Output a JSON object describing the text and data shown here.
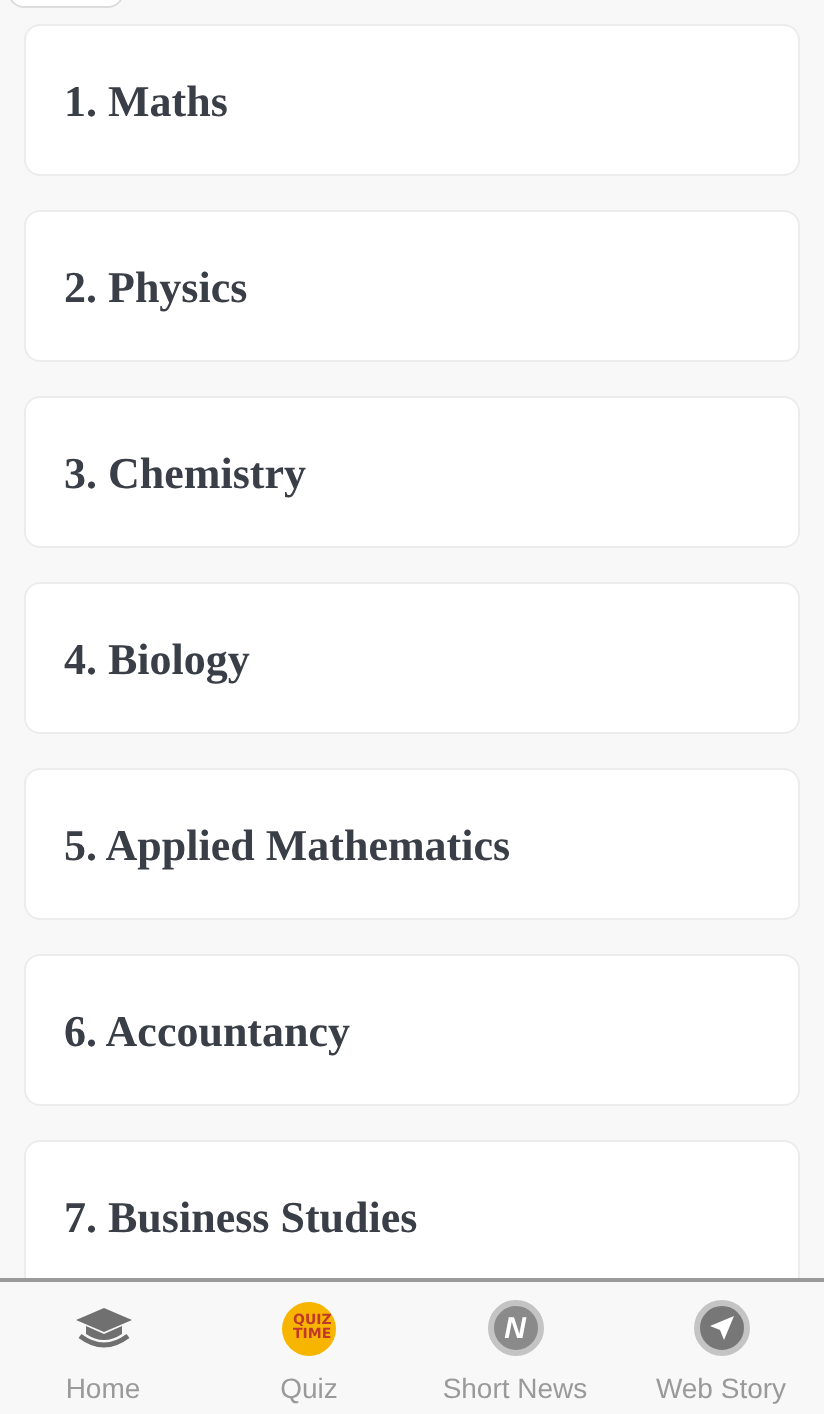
{
  "subjects": [
    {
      "label": "1. Maths"
    },
    {
      "label": "2. Physics"
    },
    {
      "label": "3. Chemistry"
    },
    {
      "label": "4. Biology"
    },
    {
      "label": "5. Applied Mathematics"
    },
    {
      "label": "6. Accountancy"
    },
    {
      "label": "7. Business Studies"
    }
  ],
  "bottom_nav": [
    {
      "kind": "home",
      "label": "Home"
    },
    {
      "kind": "quiz",
      "label": "Quiz",
      "badge_text": "QUIZ TIME"
    },
    {
      "kind": "news",
      "label": "Short News",
      "badge_text": "N"
    },
    {
      "kind": "story",
      "label": "Web Story"
    }
  ]
}
